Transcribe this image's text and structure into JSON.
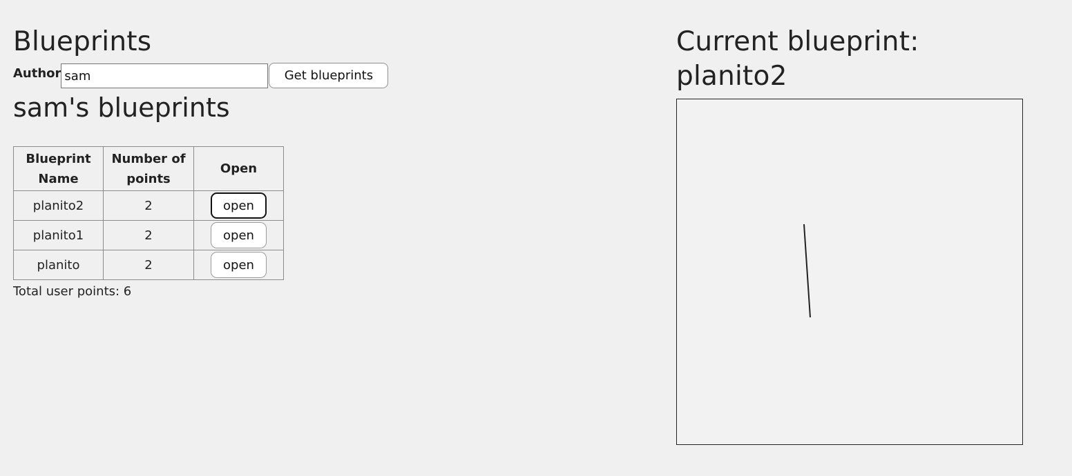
{
  "header": {
    "title": "Blueprints"
  },
  "search": {
    "author_label": "Author",
    "author_value": "sam",
    "button_label": "Get blueprints"
  },
  "list": {
    "heading": "sam's blueprints",
    "columns": [
      "Blueprint Name",
      "Number of points",
      "Open"
    ],
    "rows": [
      {
        "name": "planito2",
        "points": "2",
        "action": "open"
      },
      {
        "name": "planito1",
        "points": "2",
        "action": "open"
      },
      {
        "name": "planito",
        "points": "2",
        "action": "open"
      }
    ],
    "total": "Total user points: 6"
  },
  "current": {
    "heading": "Current blueprint: planito2"
  },
  "colors": {
    "background": "#f0f0f0",
    "text": "#222222",
    "line": "#222222"
  }
}
